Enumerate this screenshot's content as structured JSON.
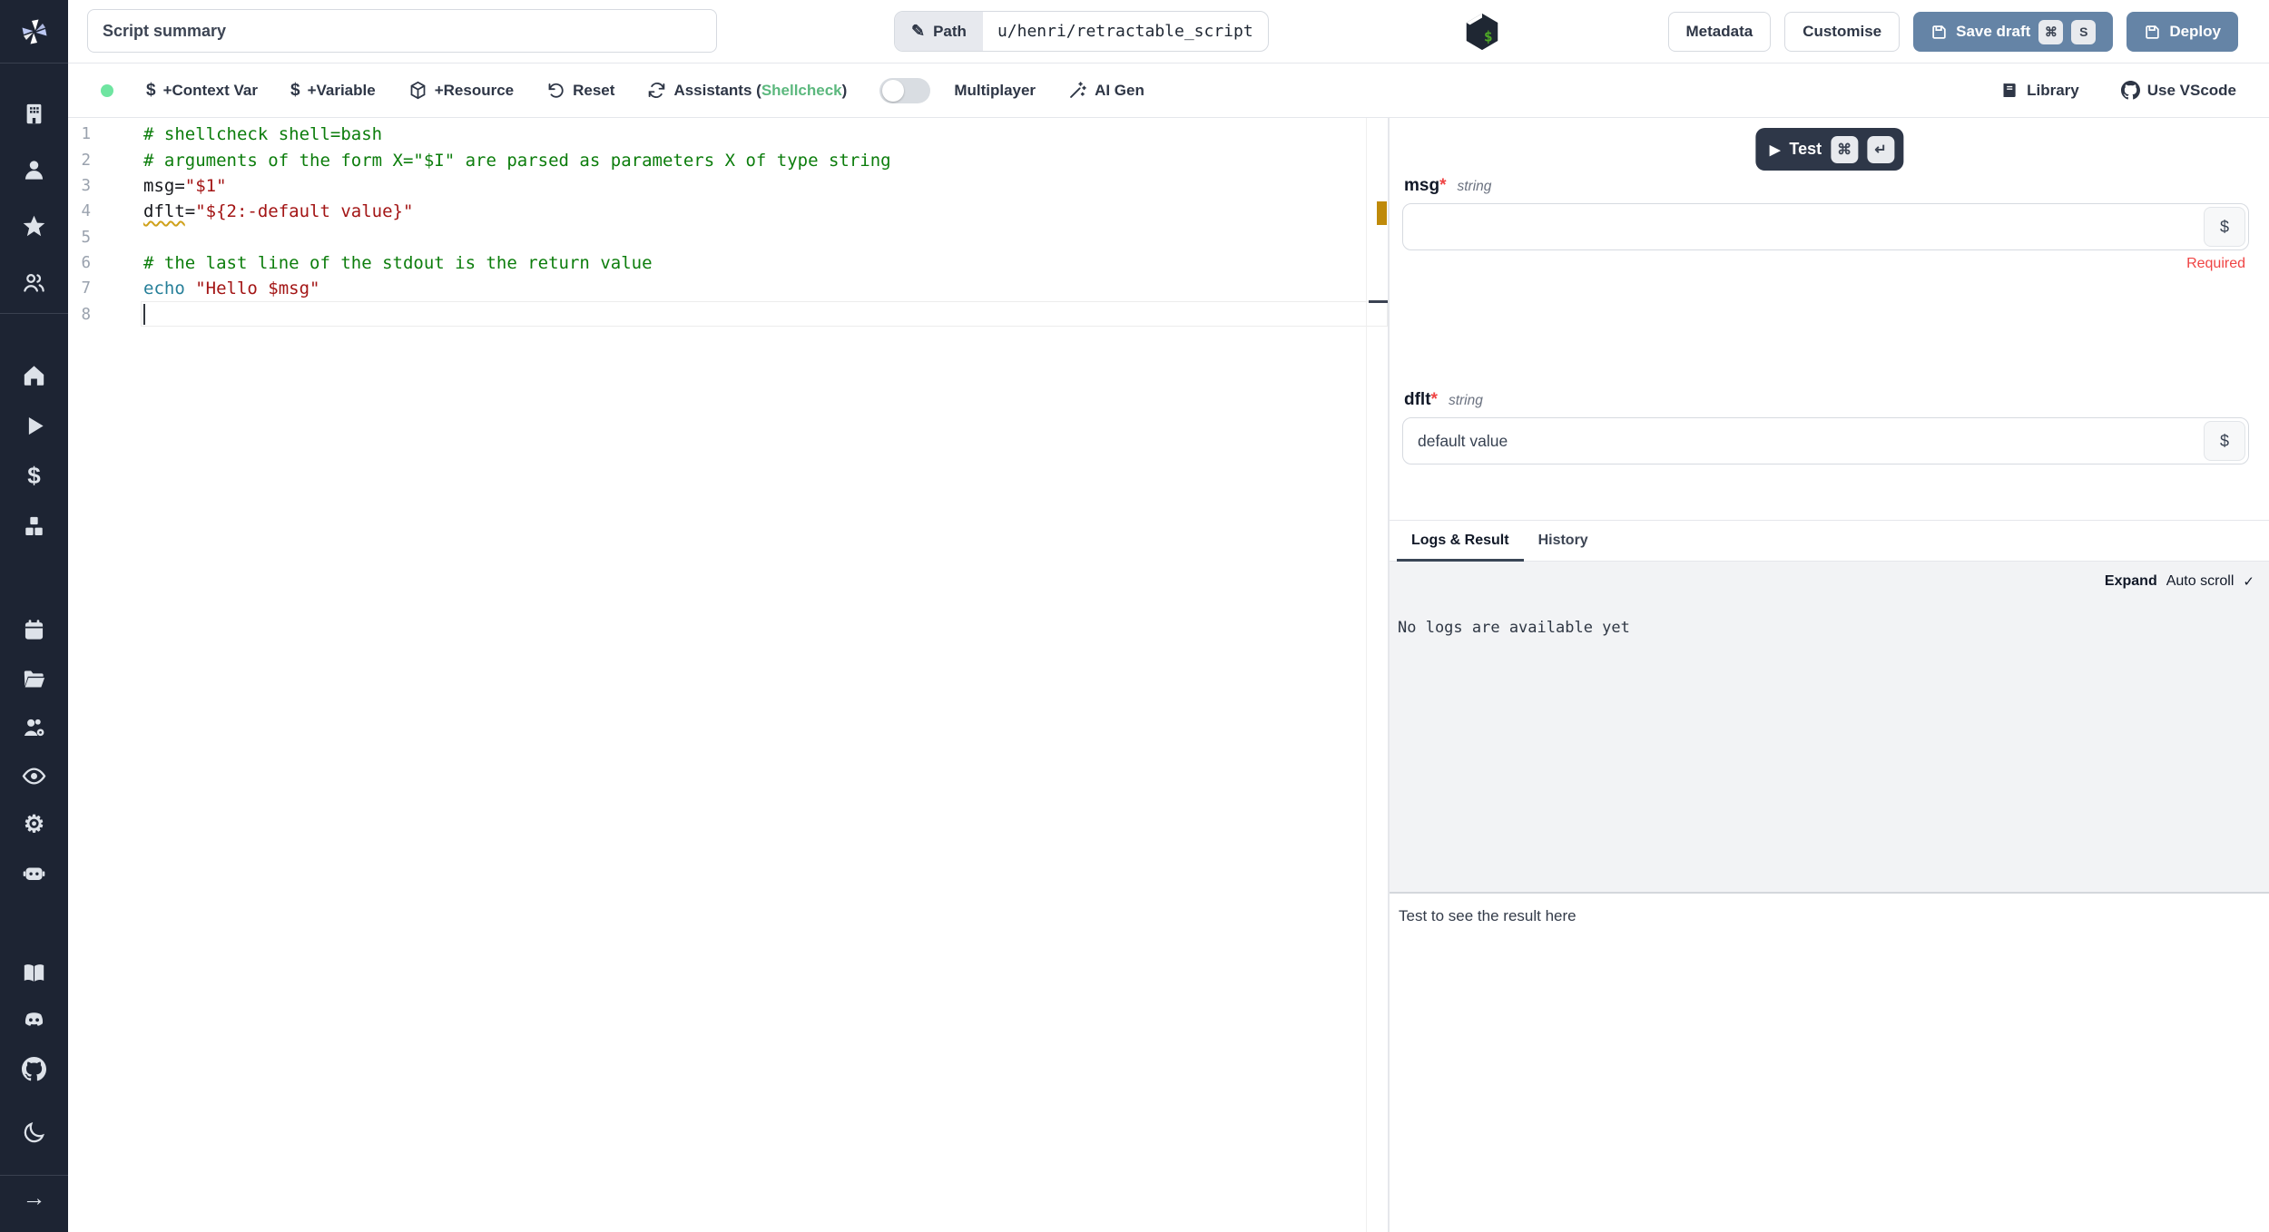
{
  "colors": {
    "sidebar_bg": "#1d2433",
    "accent_blue": "#6584a6",
    "test_dark": "#2e3748",
    "green_dot": "#6fe5a1",
    "shellcheck_green": "#5cb87e",
    "required_red": "#ef4444",
    "warning_orange": "#bf8a0a",
    "comment_green": "#0c7d0c",
    "string_red": "#a31515",
    "builtin_teal": "#267f99"
  },
  "icons": {
    "dollar": "$",
    "star": "★",
    "play": "▶",
    "moon": "☾",
    "gear": "⚙",
    "arrow_right": "→",
    "check": "✓",
    "cmd": "⌘",
    "enter": "↵",
    "s_key": "S",
    "pencil": "✎"
  },
  "topbar": {
    "summary_placeholder": "Script summary",
    "path_label": "Path",
    "path_value": "u/henri/retractable_script",
    "metadata_label": "Metadata",
    "customise_label": "Customise",
    "save_draft_label": "Save draft",
    "deploy_label": "Deploy"
  },
  "toolbar": {
    "context_var": "+Context Var",
    "variable": "+Variable",
    "resource": "+Resource",
    "reset": "Reset",
    "assistants_prefix": "Assistants (",
    "assistants_lang": "Shellcheck",
    "assistants_suffix": ")",
    "multiplayer": "Multiplayer",
    "ai_gen": "AI Gen",
    "library": "Library",
    "use_vscode": "Use VScode"
  },
  "editor": {
    "lines": [
      {
        "n": "1",
        "segs": [
          {
            "c": "comment",
            "t": "# shellcheck shell=bash"
          }
        ]
      },
      {
        "n": "2",
        "segs": [
          {
            "c": "comment",
            "t": "# arguments of the form X=\"$I\" are parsed as parameters X of type string"
          }
        ]
      },
      {
        "n": "3",
        "segs": [
          {
            "c": "plain",
            "t": "msg="
          },
          {
            "c": "string",
            "t": "\"$1\""
          }
        ]
      },
      {
        "n": "4",
        "segs": [
          {
            "c": "warn",
            "t": "dflt"
          },
          {
            "c": "plain",
            "t": "="
          },
          {
            "c": "string",
            "t": "\"${2:-default value}\""
          }
        ]
      },
      {
        "n": "5",
        "segs": []
      },
      {
        "n": "6",
        "segs": [
          {
            "c": "comment",
            "t": "# the last line of the stdout is the return value"
          }
        ]
      },
      {
        "n": "7",
        "segs": [
          {
            "c": "builtin",
            "t": "echo"
          },
          {
            "c": "plain",
            "t": " "
          },
          {
            "c": "string",
            "t": "\"Hello $msg\""
          }
        ]
      },
      {
        "n": "8",
        "segs": [],
        "cursor": true
      }
    ]
  },
  "form": {
    "test_label": "Test",
    "dollar_button": "$",
    "fields": [
      {
        "label": "msg",
        "star": "*",
        "type": "string",
        "value": "",
        "error": "Required"
      },
      {
        "label": "dflt",
        "star": "*",
        "type": "string",
        "value": "default value",
        "error": ""
      }
    ]
  },
  "tabs": {
    "logs": "Logs & Result",
    "history": "History"
  },
  "logs": {
    "expand": "Expand",
    "autoscroll": "Auto scroll",
    "empty": "No logs are available yet"
  },
  "result": {
    "placeholder": "Test to see the result here"
  }
}
